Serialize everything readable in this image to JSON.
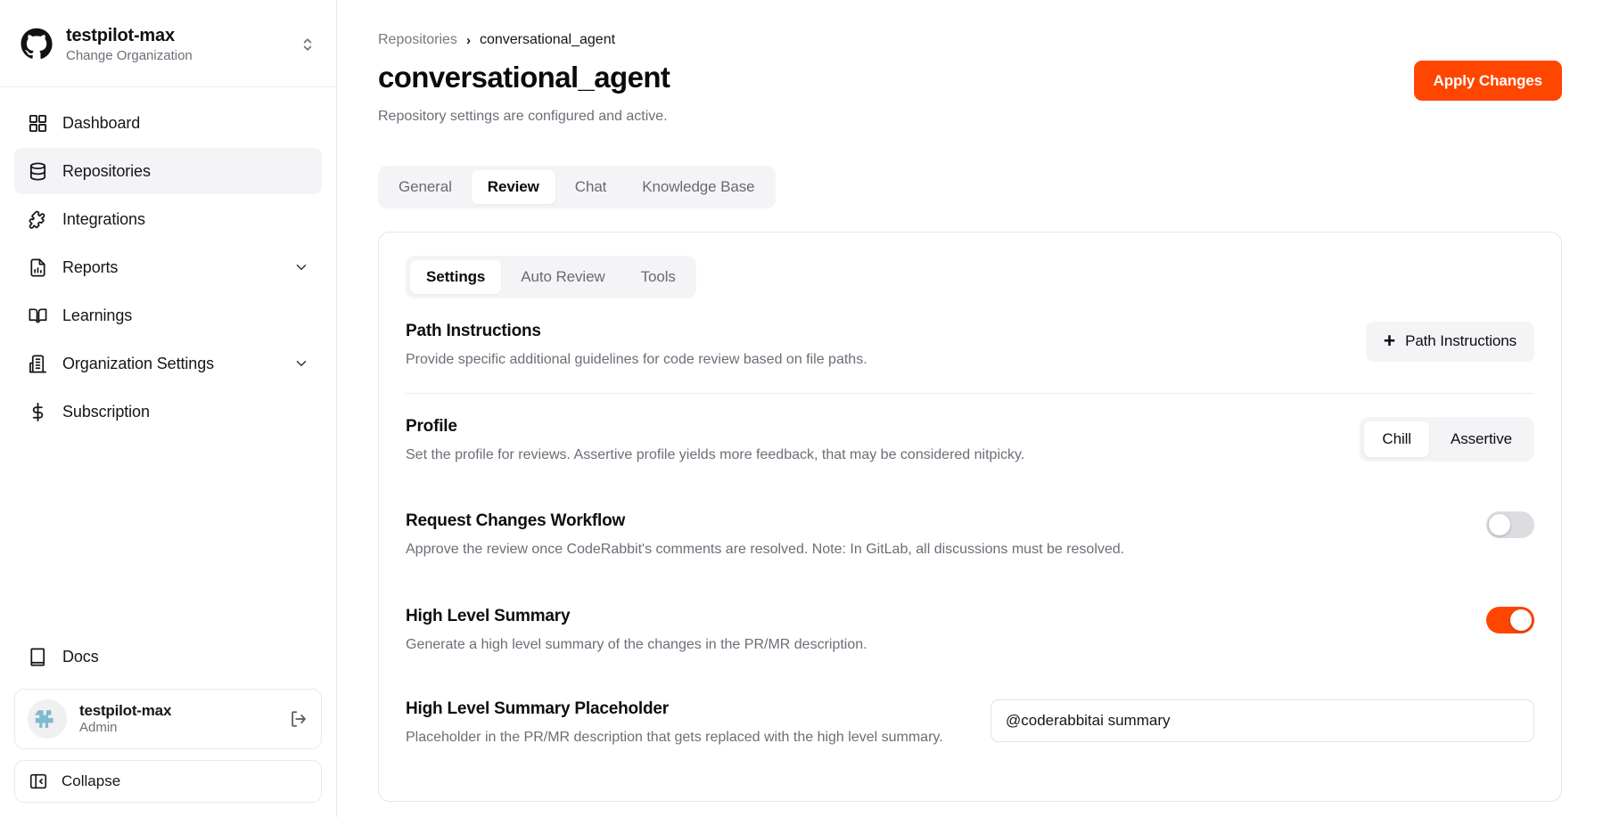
{
  "sidebar": {
    "org": {
      "icon": "github-logo-icon",
      "name": "testpilot-max",
      "subtitle": "Change Organization",
      "switcher_icon": "chevron-updown-icon"
    },
    "items": [
      {
        "label": "Dashboard",
        "icon": "grid-icon",
        "active": false,
        "chevron": false
      },
      {
        "label": "Repositories",
        "icon": "database-icon",
        "active": true,
        "chevron": false
      },
      {
        "label": "Integrations",
        "icon": "puzzle-icon",
        "active": false,
        "chevron": false
      },
      {
        "label": "Reports",
        "icon": "report-chart-icon",
        "active": false,
        "chevron": true
      },
      {
        "label": "Learnings",
        "icon": "book-open-icon",
        "active": false,
        "chevron": false
      },
      {
        "label": "Organization Settings",
        "icon": "building-icon",
        "active": false,
        "chevron": true
      },
      {
        "label": "Subscription",
        "icon": "dollar-icon",
        "active": false,
        "chevron": false
      }
    ],
    "docs": {
      "label": "Docs",
      "icon": "book-closed-icon"
    },
    "user": {
      "name": "testpilot-max",
      "role": "Admin",
      "logout_icon": "logout-icon",
      "avatar_icon": "avatar-icon"
    },
    "collapse": {
      "label": "Collapse",
      "icon": "panel-collapse-icon"
    }
  },
  "main": {
    "breadcrumb": {
      "root": "Repositories",
      "separator": "›",
      "current": "conversational_agent"
    },
    "title": "conversational_agent",
    "subtitle": "Repository settings are configured and active.",
    "apply_button": "Apply Changes",
    "tabs": [
      {
        "label": "General",
        "active": false
      },
      {
        "label": "Review",
        "active": true
      },
      {
        "label": "Chat",
        "active": false
      },
      {
        "label": "Knowledge Base",
        "active": false
      }
    ],
    "subtabs": [
      {
        "label": "Settings",
        "active": true
      },
      {
        "label": "Auto Review",
        "active": false
      },
      {
        "label": "Tools",
        "active": false
      }
    ],
    "settings": [
      {
        "id": "path-instructions",
        "title": "Path Instructions",
        "description": "Provide specific additional guidelines for code review based on file paths.",
        "control": "button",
        "button_label": "Path Instructions",
        "button_icon": "plus-icon"
      },
      {
        "id": "profile",
        "title": "Profile",
        "description": "Set the profile for reviews. Assertive profile yields more feedback, that may be considered nitpicky.",
        "control": "segmented",
        "options": [
          {
            "label": "Chill",
            "selected": true
          },
          {
            "label": "Assertive",
            "selected": false
          }
        ]
      },
      {
        "id": "request-changes-workflow",
        "title": "Request Changes Workflow",
        "description": "Approve the review once CodeRabbit's comments are resolved. Note: In GitLab, all discussions must be resolved.",
        "control": "toggle",
        "enabled": false
      },
      {
        "id": "high-level-summary",
        "title": "High Level Summary",
        "description": "Generate a high level summary of the changes in the PR/MR description.",
        "control": "toggle",
        "enabled": true
      },
      {
        "id": "high-level-summary-placeholder",
        "title": "High Level Summary Placeholder",
        "description": "Placeholder in the PR/MR description that gets replaced with the high level summary.",
        "control": "input",
        "value": "@coderabbitai summary"
      }
    ]
  },
  "colors": {
    "accent": "#ff4600",
    "muted": "#6d6d78",
    "panel_bg": "#f4f4f6",
    "avatar_accent": "#7fbbcc"
  }
}
